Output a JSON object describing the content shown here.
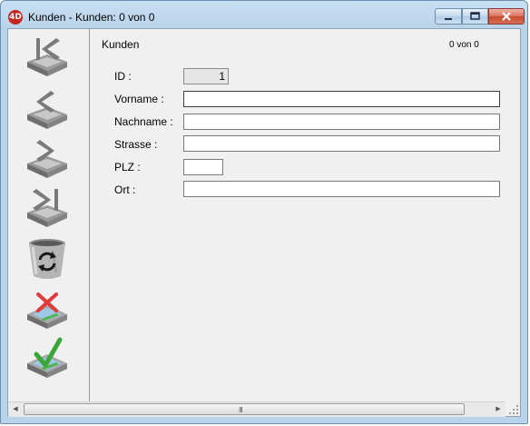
{
  "window": {
    "app_icon_text": "4D",
    "title": "Kunden - Kunden: 0 von 0",
    "controls": {
      "minimize": "minimize-icon",
      "maximize": "maximize-icon",
      "close": "close-icon"
    }
  },
  "toolbar": {
    "buttons": [
      {
        "name": "first-record",
        "icon": "first-record-icon"
      },
      {
        "name": "previous-record",
        "icon": "previous-record-icon"
      },
      {
        "name": "next-record",
        "icon": "next-record-icon"
      },
      {
        "name": "last-record",
        "icon": "last-record-icon"
      },
      {
        "name": "delete-record",
        "icon": "trash-icon"
      },
      {
        "name": "cancel",
        "icon": "cancel-icon"
      },
      {
        "name": "accept",
        "icon": "accept-icon"
      }
    ]
  },
  "form": {
    "title": "Kunden",
    "record_count": "0 von 0",
    "fields": {
      "id": {
        "label": "ID :",
        "value": "1"
      },
      "vorname": {
        "label": "Vorname :",
        "value": ""
      },
      "nachname": {
        "label": "Nachname :",
        "value": ""
      },
      "strasse": {
        "label": "Strasse :",
        "value": ""
      },
      "plz": {
        "label": "PLZ :",
        "value": ""
      },
      "ort": {
        "label": "Ort :",
        "value": ""
      }
    }
  },
  "scrollbar": {
    "grip": "III"
  },
  "colors": {
    "accent_red": "#c8231f",
    "title_bar": "#b9d3ea",
    "client": "#f0f0f0",
    "check_green": "#3aa63a"
  }
}
